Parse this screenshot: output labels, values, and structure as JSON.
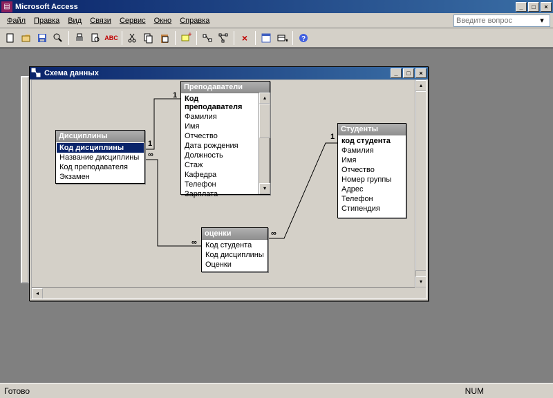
{
  "app": {
    "title": "Microsoft Access"
  },
  "menu": {
    "items": [
      "Файл",
      "Правка",
      "Вид",
      "Связи",
      "Сервис",
      "Окно",
      "Справка"
    ],
    "question_placeholder": "Введите вопрос"
  },
  "schema_window": {
    "title": "Схема данных"
  },
  "tables": {
    "disciplines": {
      "title": "Дисциплины",
      "fields": [
        "Код дисциплины",
        "Название дисциплины",
        "Код преподавателя",
        "Экзамен"
      ]
    },
    "teachers": {
      "title": "Преподаватели",
      "fields": [
        "Код преподавателя",
        "Фамилия",
        "Имя",
        "Отчество",
        "Дата рождения",
        "Должность",
        "Стаж",
        "Кафедра",
        "Телефон",
        "Зарплата"
      ]
    },
    "grades": {
      "title": "оценки",
      "fields": [
        "Код студента",
        "Код дисциплины",
        "Оценки"
      ]
    },
    "students": {
      "title": "Студенты",
      "fields": [
        "код студента",
        "Фамилия",
        "Имя",
        "Отчество",
        "Номер группы",
        "Адрес",
        "Телефон",
        "Стипендия"
      ]
    }
  },
  "rel_labels": {
    "one": "1",
    "many": "∞"
  },
  "status": {
    "ready": "Готово",
    "num": "NUM"
  }
}
